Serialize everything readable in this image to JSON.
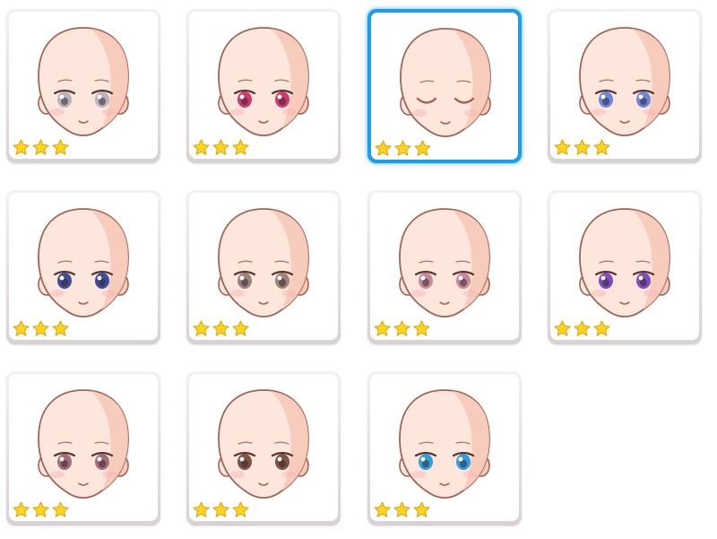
{
  "selected_index": 2,
  "colors": {
    "skin": "#fde6dc",
    "skin_shade": "#f6c9b8",
    "outline": "#a06557",
    "selection_border": "#1c9fe6",
    "star": "#ffd51f"
  },
  "items": [
    {
      "icon": "face-icon",
      "eye_color": "#b9b3bb",
      "style": "open",
      "stars": 3
    },
    {
      "icon": "face-icon",
      "eye_color": "#cc3b6e",
      "style": "open",
      "stars": 3
    },
    {
      "icon": "face-icon",
      "eye_color": "#8b5b50",
      "style": "closed",
      "stars": 3
    },
    {
      "icon": "face-icon",
      "eye_color": "#6c88dd",
      "style": "open",
      "stars": 3
    },
    {
      "icon": "face-icon",
      "eye_color": "#3e4e9b",
      "style": "open",
      "stars": 3
    },
    {
      "icon": "face-icon",
      "eye_color": "#9c8577",
      "style": "open",
      "stars": 3
    },
    {
      "icon": "face-icon",
      "eye_color": "#c58a9a",
      "style": "open",
      "stars": 3
    },
    {
      "icon": "face-icon",
      "eye_color": "#7b4fc0",
      "style": "open",
      "stars": 3
    },
    {
      "icon": "face-icon",
      "eye_color": "#a56e76",
      "style": "open",
      "stars": 3
    },
    {
      "icon": "face-icon",
      "eye_color": "#7d5342",
      "style": "open",
      "stars": 3
    },
    {
      "icon": "face-icon",
      "eye_color": "#2f9fe0",
      "style": "open",
      "stars": 3
    }
  ]
}
